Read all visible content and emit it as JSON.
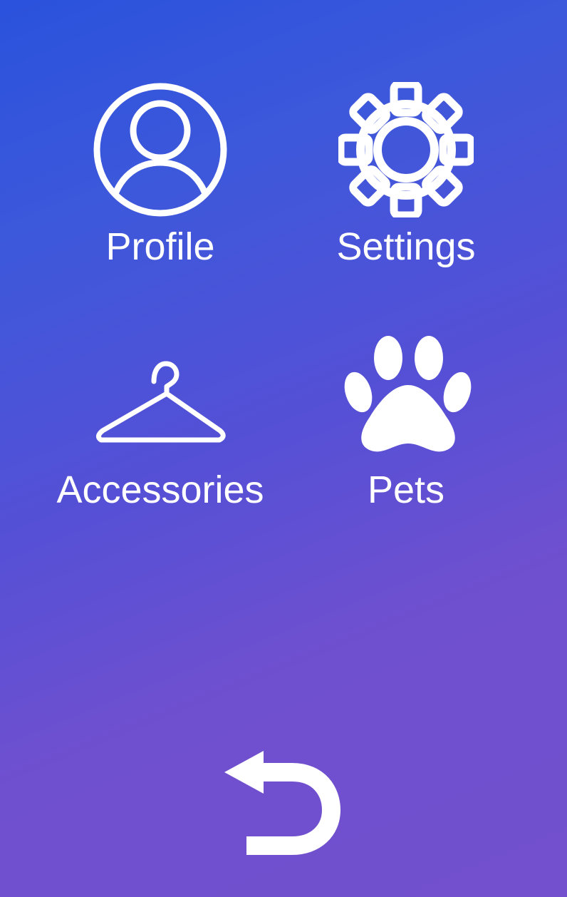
{
  "menu": {
    "items": [
      {
        "label": "Profile",
        "icon": "profile-icon"
      },
      {
        "label": "Settings",
        "icon": "gear-icon"
      },
      {
        "label": "Accessories",
        "icon": "hanger-icon"
      },
      {
        "label": "Pets",
        "icon": "paw-icon"
      }
    ]
  },
  "navigation": {
    "back_icon": "back-arrow-icon"
  },
  "colors": {
    "foreground": "#ffffff",
    "gradient_start": "#2a52dc",
    "gradient_end": "#7250ce"
  }
}
